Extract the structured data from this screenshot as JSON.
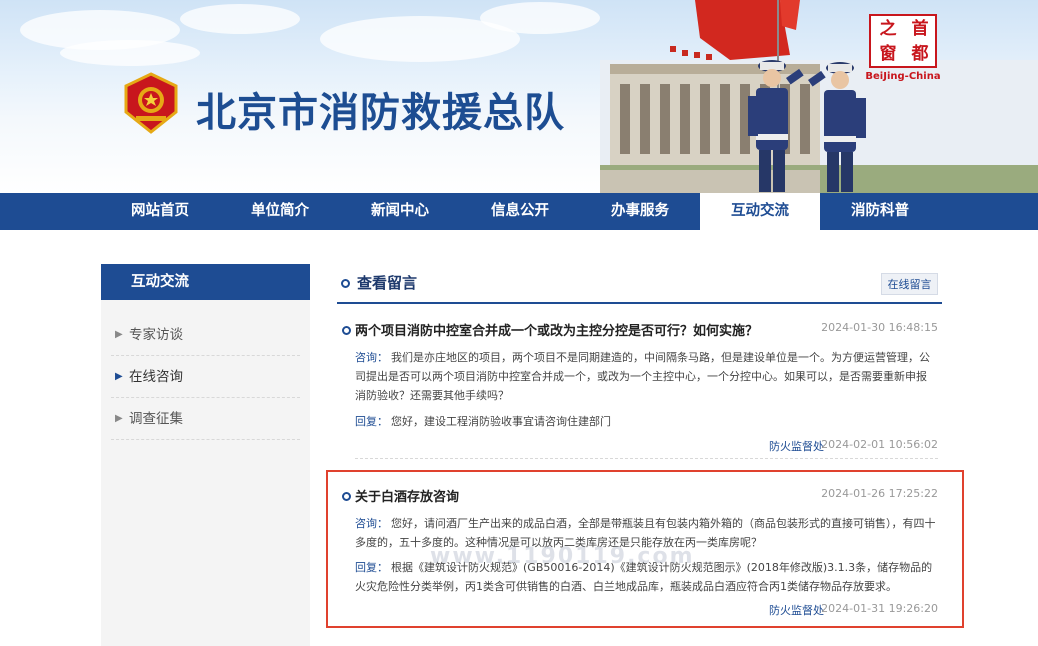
{
  "header": {
    "site_title": "北京市消防救援总队",
    "stamp_chars": [
      "之",
      "首",
      "窗",
      "都"
    ],
    "stamp_sub": "BeiJing-China"
  },
  "nav": {
    "items": [
      {
        "label": "网站首页",
        "active": false
      },
      {
        "label": "单位简介",
        "active": false
      },
      {
        "label": "新闻中心",
        "active": false
      },
      {
        "label": "信息公开",
        "active": false
      },
      {
        "label": "办事服务",
        "active": false
      },
      {
        "label": "互动交流",
        "active": true
      },
      {
        "label": "消防科普",
        "active": false
      }
    ]
  },
  "sidebar": {
    "title": "互动交流",
    "items": [
      {
        "label": "专家访谈",
        "active": false
      },
      {
        "label": "在线咨询",
        "active": true
      },
      {
        "label": "调查征集",
        "active": false
      }
    ]
  },
  "main": {
    "section_title": "查看留言",
    "online_button": "在线留言",
    "posts": [
      {
        "title": "两个项目消防中控室合并成一个或改为主控分控是否可行？如何实施？",
        "time": "2024-01-30 16:48:15",
        "q_label": "咨询：",
        "question": "我们是亦庄地区的项目，两个项目不是同期建造的，中间隔条马路，但是建设单位是一个。为方便运营管理，公司提出是否可以两个项目消防中控室合并成一个，或改为一个主控中心，一个分控中心。如果可以，是否需要重新申报消防验收？还需要其他手续吗？",
        "a_label": "回复：",
        "answer": "您好，建设工程消防验收事宜请咨询住建部门",
        "reply_by": "防火监督处",
        "reply_time": "2024-02-01 10:56:02"
      },
      {
        "title": "关于白酒存放咨询",
        "time": "2024-01-26 17:25:22",
        "q_label": "咨询：",
        "question": "您好，请问酒厂生产出来的成品白酒，全部是带瓶装且有包装内箱外箱的（商品包装形式的直接可销售），有四十多度的，五十多度的。这种情况是可以放丙二类库房还是只能存放在丙一类库房呢？",
        "a_label": "回复：",
        "answer": "根据《建筑设计防火规范》(GB50016-2014)《建筑设计防火规范图示》(2018年修改版)3.1.3条，储存物品的火灾危险性分类举例，丙1类含可供销售的白酒、白兰地成品库，瓶装成品白酒应符合丙1类储存物品存放要求。",
        "reply_by": "防火监督处",
        "reply_time": "2024-01-31 19:26:20"
      }
    ]
  },
  "watermark": "www.1190119.com",
  "colors": {
    "primary": "#1e4c93",
    "highlight": "#e0412e",
    "flag": "#d2281f"
  }
}
